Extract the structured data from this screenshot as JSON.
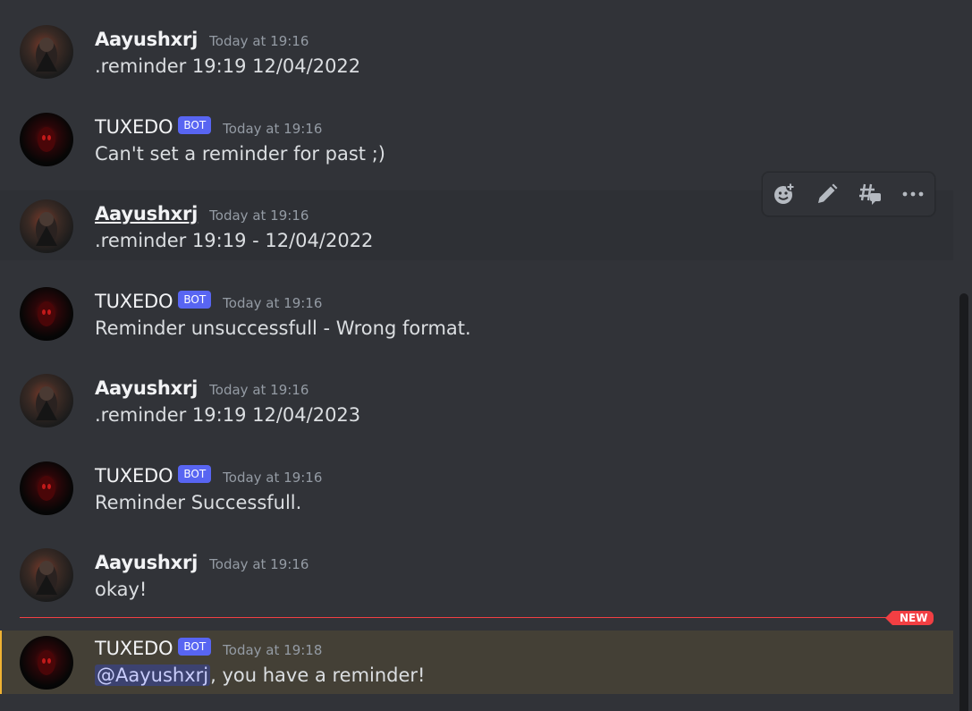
{
  "messages": [
    {
      "author": "Aayushxrj",
      "time": "Today at 19:16",
      "text": ".reminder 19:19 12/04/2022"
    },
    {
      "author": "TUXEDO",
      "badge": "BOT",
      "time": "Today at 19:16",
      "text": "Can't set a reminder for past ;)"
    },
    {
      "author": "Aayushxrj",
      "time": "Today at 19:16",
      "text": ".reminder 19:19 - 12/04/2022"
    },
    {
      "author": "TUXEDO",
      "badge": "BOT",
      "time": "Today at 19:16",
      "text": "Reminder unsuccessfull - Wrong format."
    },
    {
      "author": "Aayushxrj",
      "time": "Today at 19:16",
      "text": ".reminder 19:19 12/04/2023"
    },
    {
      "author": "TUXEDO",
      "badge": "BOT",
      "time": "Today at 19:16",
      "text": "Reminder Successfull."
    },
    {
      "author": "Aayushxrj",
      "time": "Today at 19:16",
      "text": "okay!"
    },
    {
      "author": "TUXEDO",
      "badge": "BOT",
      "time": "Today at 19:18",
      "mention": "@Aayushxrj",
      "text": ", you have a reminder!"
    }
  ],
  "new_divider": {
    "label": "NEW"
  },
  "toolbar": {
    "icons": [
      "add-reaction-icon",
      "edit-icon",
      "create-thread-icon",
      "more-icon"
    ]
  },
  "colors": {
    "background": "#313338",
    "bot_badge": "#5865f2",
    "new_divider": "#f23f43",
    "mention_highlight": "#444036",
    "mention_bar": "#f0b232"
  }
}
